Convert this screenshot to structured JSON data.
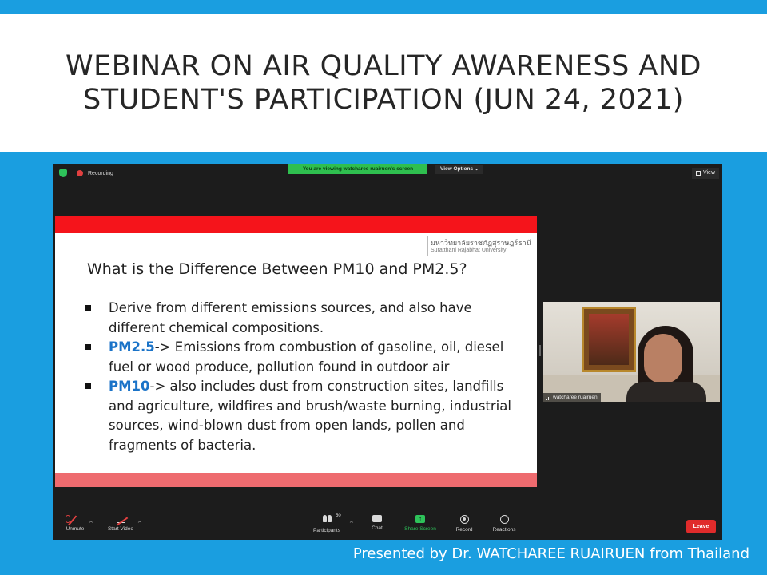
{
  "slide": {
    "title_line1": "WEBINAR ON AIR QUALITY AWARENESS AND",
    "title_line2": "STUDENT'S PARTICIPATION (JUN 24, 2021)",
    "presenter": "Presented by Dr. WATCHAREE RUAIRUEN from Thailand",
    "colors": {
      "background": "#1a9ee0",
      "band": "#ffffff"
    }
  },
  "zoom": {
    "recording_label": "Recording",
    "viewing_banner": "You are viewing watcharee ruairuen's screen",
    "view_options_label": "View Options ⌄",
    "view_label": "View",
    "participant_name": "watcharee ruairuen",
    "toolbar": {
      "unmute": "Unmute",
      "start_video": "Start Video",
      "participants": "Participants",
      "participant_count": "50",
      "chat": "Chat",
      "share_screen": "Share Screen",
      "record": "Record",
      "reactions": "Reactions",
      "leave": "Leave",
      "caret": "^"
    },
    "colors": {
      "window": "#1c1c1c",
      "banner": "#2fbf4f",
      "leave": "#e02b2b",
      "share": "#2ec35a"
    }
  },
  "shared_slide": {
    "university_thai": "มหาวิทยาลัยราชภัฏสุราษฎร์ธานี",
    "university_en": "Suratthani Rajabhat University",
    "heading": "What is the Difference Between PM10 and PM2.5?",
    "bullets": [
      {
        "term": "",
        "text": "Derive from different emissions sources, and also have different chemical compositions."
      },
      {
        "term": "PM2.5",
        "text": "-> Emissions from combustion of gasoline, oil, diesel fuel or wood produce, pollution found in outdoor air"
      },
      {
        "term": "PM10",
        "text": "-> also includes dust from construction sites, landfills and agriculture, wildfires and brush/waste burning, industrial sources, wind-blown dust from open lands, pollen and fragments of bacteria."
      }
    ],
    "colors": {
      "top_bar": "#f5141b",
      "bottom_bar": "#ee6b6f",
      "term": "#1a73c8"
    }
  }
}
